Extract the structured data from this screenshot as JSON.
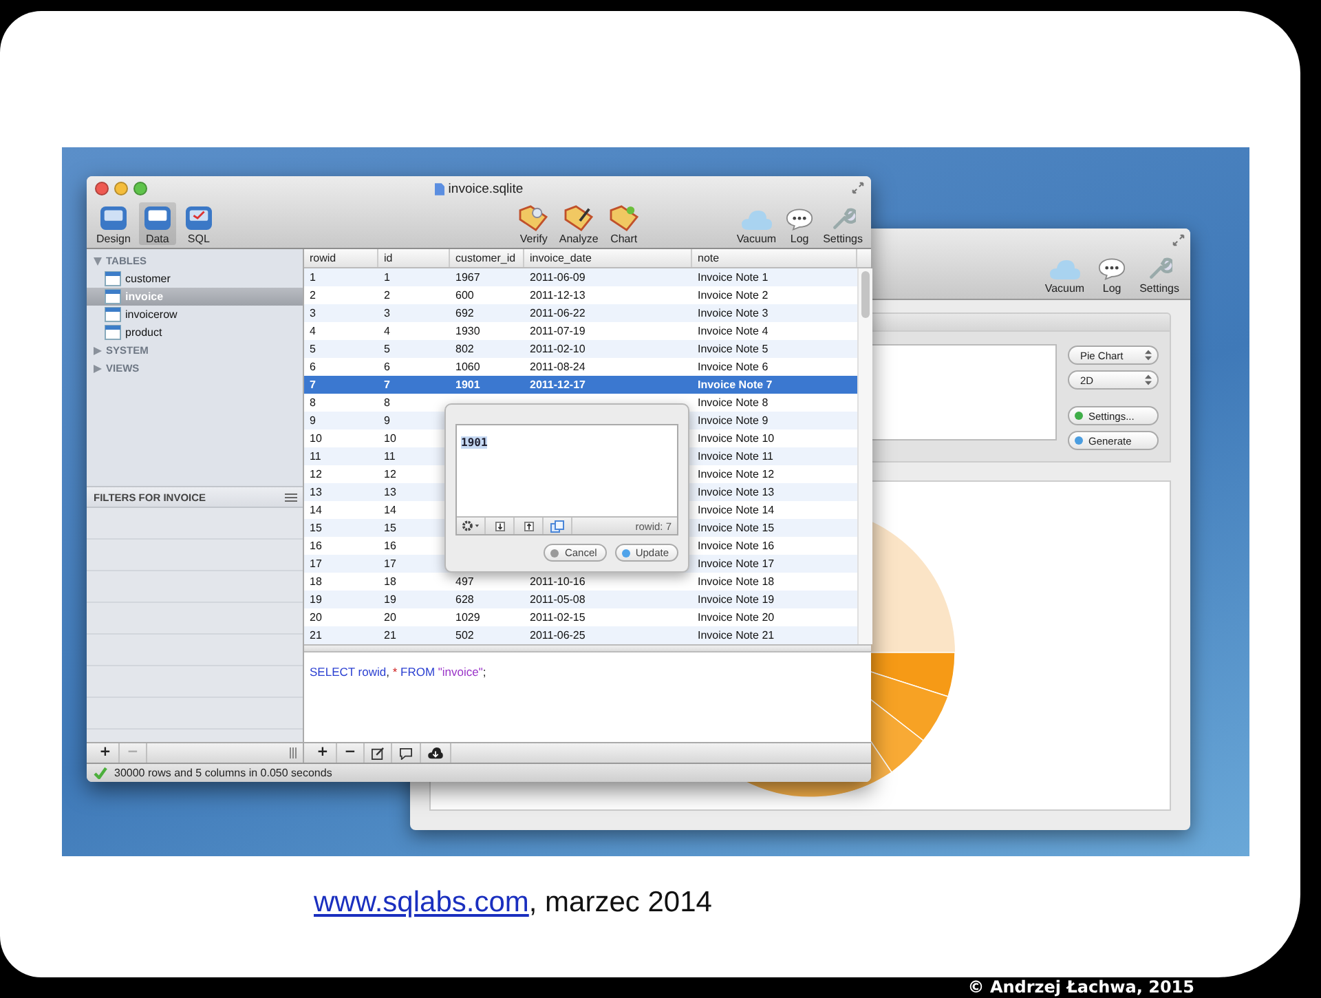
{
  "back_window": {
    "toolbar": [
      {
        "label": "Vacuum"
      },
      {
        "label": "Log"
      },
      {
        "label": "Settings"
      }
    ],
    "chart_type": "Pie Chart",
    "dimension": "2D",
    "buttons": [
      {
        "label": "Settings...",
        "color": "#3fae49"
      },
      {
        "label": "Generate",
        "color": "#4a9de0"
      }
    ]
  },
  "window": {
    "title": "invoice.sqlite",
    "toolbar_left": [
      {
        "label": "Design",
        "selected": false
      },
      {
        "label": "Data",
        "selected": true
      },
      {
        "label": "SQL",
        "selected": false
      }
    ],
    "toolbar_center": [
      {
        "label": "Verify"
      },
      {
        "label": "Analyze"
      },
      {
        "label": "Chart"
      }
    ],
    "toolbar_right": [
      {
        "label": "Vacuum"
      },
      {
        "label": "Log"
      },
      {
        "label": "Settings"
      }
    ]
  },
  "sidebar": {
    "sections": [
      {
        "label": "TABLES",
        "expanded": true,
        "children": [
          {
            "label": "customer",
            "selected": false
          },
          {
            "label": "invoice",
            "selected": true
          },
          {
            "label": "invoicerow",
            "selected": false
          },
          {
            "label": "product",
            "selected": false
          }
        ]
      },
      {
        "label": "SYSTEM",
        "expanded": false
      },
      {
        "label": "VIEWS",
        "expanded": false
      }
    ],
    "filters_title": "FILTERS FOR INVOICE",
    "buttons": [
      "+",
      "−"
    ]
  },
  "table": {
    "columns": [
      "rowid",
      "id",
      "customer_id",
      "invoice_date",
      "note"
    ],
    "rows": [
      {
        "selected": false,
        "cells": [
          "1",
          "1",
          "1967",
          "2011-06-09",
          "Invoice Note 1"
        ]
      },
      {
        "selected": false,
        "cells": [
          "2",
          "2",
          "600",
          "2011-12-13",
          "Invoice Note 2"
        ]
      },
      {
        "selected": false,
        "cells": [
          "3",
          "3",
          "692",
          "2011-06-22",
          "Invoice Note 3"
        ]
      },
      {
        "selected": false,
        "cells": [
          "4",
          "4",
          "1930",
          "2011-07-19",
          "Invoice Note 4"
        ]
      },
      {
        "selected": false,
        "cells": [
          "5",
          "5",
          "802",
          "2011-02-10",
          "Invoice Note 5"
        ]
      },
      {
        "selected": false,
        "cells": [
          "6",
          "6",
          "1060",
          "2011-08-24",
          "Invoice Note 6"
        ]
      },
      {
        "selected": true,
        "cells": [
          "7",
          "7",
          "1901",
          "2011-12-17",
          "Invoice Note 7"
        ]
      },
      {
        "selected": false,
        "cells": [
          "8",
          "8",
          null,
          null,
          "Invoice Note 8"
        ]
      },
      {
        "selected": false,
        "cells": [
          "9",
          "9",
          null,
          null,
          "Invoice Note 9"
        ]
      },
      {
        "selected": false,
        "cells": [
          "10",
          "10",
          null,
          null,
          "Invoice Note 10"
        ]
      },
      {
        "selected": false,
        "cells": [
          "11",
          "11",
          null,
          null,
          "Invoice Note 11"
        ]
      },
      {
        "selected": false,
        "cells": [
          "12",
          "12",
          null,
          null,
          "Invoice Note 12"
        ]
      },
      {
        "selected": false,
        "cells": [
          "13",
          "13",
          null,
          null,
          "Invoice Note 13"
        ]
      },
      {
        "selected": false,
        "cells": [
          "14",
          "14",
          null,
          null,
          "Invoice Note 14"
        ]
      },
      {
        "selected": false,
        "cells": [
          "15",
          "15",
          null,
          null,
          "Invoice Note 15"
        ]
      },
      {
        "selected": false,
        "cells": [
          "16",
          "16",
          null,
          null,
          "Invoice Note 16"
        ]
      },
      {
        "selected": false,
        "cells": [
          "17",
          "17",
          null,
          null,
          "Invoice Note 17"
        ]
      },
      {
        "selected": false,
        "cells": [
          "18",
          "18",
          "497",
          "2011-10-16",
          "Invoice Note 18"
        ]
      },
      {
        "selected": false,
        "cells": [
          "19",
          "19",
          "628",
          "2011-05-08",
          "Invoice Note 19"
        ]
      },
      {
        "selected": false,
        "cells": [
          "20",
          "20",
          "1029",
          "2011-02-15",
          "Invoice Note 20"
        ]
      },
      {
        "selected": false,
        "cells": [
          "21",
          "21",
          "502",
          "2011-06-25",
          "Invoice Note 21"
        ]
      }
    ]
  },
  "popover": {
    "value": "1901",
    "rowid_label": "rowid: 7",
    "buttons": [
      {
        "label": "Cancel",
        "kind": "cancel"
      },
      {
        "label": "Update",
        "kind": "default"
      }
    ]
  },
  "sql": {
    "tokens": [
      {
        "text": "SELECT rowid",
        "kind": "keyword"
      },
      {
        "text": ", ",
        "kind": "plain"
      },
      {
        "text": "*",
        "kind": "operator"
      },
      {
        "text": " FROM ",
        "kind": "keyword"
      },
      {
        "text": "\"invoice\"",
        "kind": "string"
      },
      {
        "text": ";",
        "kind": "plain"
      }
    ]
  },
  "bottom_toolbar": {
    "buttons": [
      "+",
      "−"
    ]
  },
  "status_bar": {
    "text": "30000 rows and 5 columns in 0.050 seconds"
  },
  "slide": {
    "caption_link": "www.sqlabs.com",
    "caption_rest": ", marzec 2014",
    "credit": "© Andrzej Łachwa, 2015"
  }
}
